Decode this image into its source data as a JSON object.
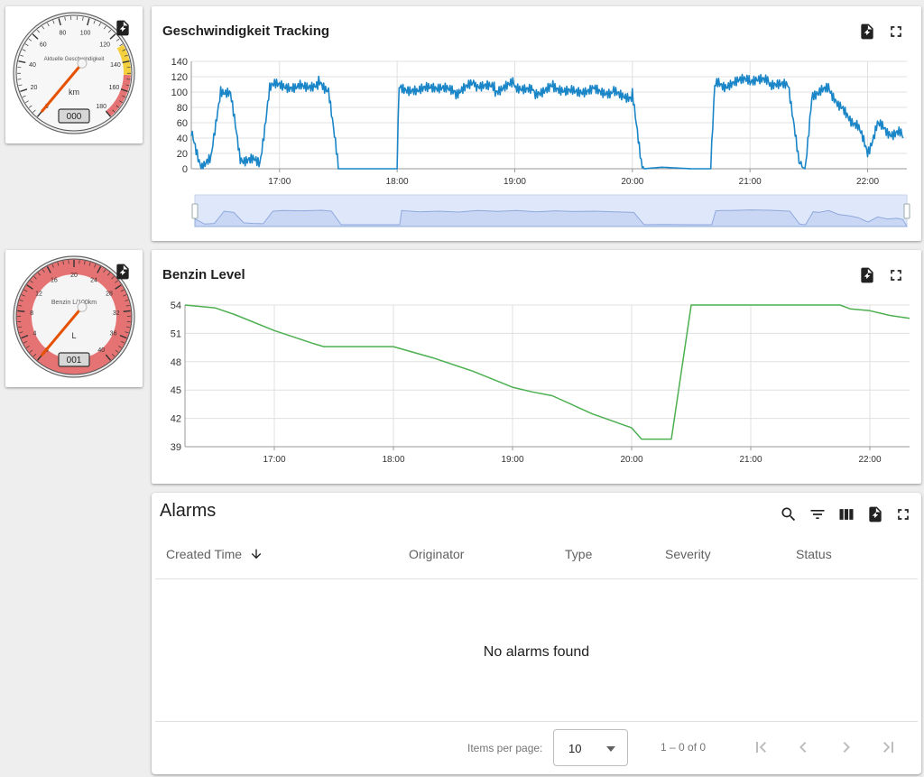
{
  "gauge_speed": {
    "label": "Aktuelle Geschwindigkeit",
    "unit": "km",
    "value_display": "000",
    "ticks": [
      "0",
      "20",
      "40",
      "60",
      "80",
      "100",
      "120",
      "140",
      "160",
      "180"
    ]
  },
  "gauge_fuel": {
    "label": "Benzin L/100km",
    "unit": "L",
    "value_display": "001",
    "ticks": [
      "0",
      "4",
      "8",
      "12",
      "16",
      "20",
      "24",
      "28",
      "32",
      "36",
      "40"
    ]
  },
  "speed_chart": {
    "title": "Geschwindigkeit Tracking"
  },
  "fuel_chart": {
    "title": "Benzin Level"
  },
  "chart_data": [
    {
      "type": "line",
      "title": "Geschwindigkeit Tracking",
      "x_unit": "time",
      "x": [
        "16:15",
        "16:20",
        "16:25",
        "16:30",
        "16:35",
        "16:40",
        "16:45",
        "16:50",
        "16:55",
        "17:00",
        "17:10",
        "17:20",
        "17:25",
        "17:30",
        "17:35",
        "17:40",
        "17:45",
        "17:50",
        "17:55",
        "18:00",
        "18:01",
        "18:10",
        "18:20",
        "18:30",
        "18:40",
        "18:50",
        "19:00",
        "19:10",
        "19:20",
        "19:30",
        "19:40",
        "19:50",
        "20:00",
        "20:05",
        "20:06",
        "20:15",
        "20:30",
        "20:40",
        "20:42",
        "20:45",
        "20:50",
        "21:00",
        "21:10",
        "21:20",
        "21:25",
        "21:28",
        "21:32",
        "21:35",
        "21:40",
        "21:45",
        "21:50",
        "21:55",
        "22:00",
        "22:05",
        "22:10",
        "22:15",
        "22:18"
      ],
      "series": [
        {
          "values": [
            45,
            5,
            10,
            105,
            95,
            15,
            10,
            8,
            105,
            110,
            108,
            112,
            105,
            0,
            0,
            0,
            0,
            0,
            0,
            0,
            110,
            100,
            105,
            98,
            110,
            103,
            110,
            100,
            108,
            102,
            105,
            100,
            95,
            5,
            0,
            2,
            0,
            0,
            108,
            110,
            110,
            115,
            112,
            105,
            5,
            0,
            100,
            95,
            110,
            80,
            70,
            55,
            20,
            60,
            45,
            50,
            40
          ],
          "color": "#1a86c8"
        }
      ],
      "xlim": [
        "16:15",
        "22:20"
      ],
      "xticks": [
        "17:00",
        "18:00",
        "19:00",
        "20:00",
        "21:00",
        "22:00"
      ],
      "ylim": [
        0,
        140
      ],
      "yticks": [
        "0",
        "20",
        "40",
        "60",
        "80",
        "100",
        "120",
        "140"
      ],
      "grid": true
    },
    {
      "type": "line",
      "title": "Benzin Level",
      "x_unit": "time",
      "x": [
        "16:15",
        "16:30",
        "16:40",
        "17:00",
        "17:20",
        "17:25",
        "17:40",
        "18:00",
        "18:20",
        "18:40",
        "19:00",
        "19:10",
        "19:20",
        "19:40",
        "20:00",
        "20:05",
        "20:20",
        "20:30",
        "20:45",
        "21:00",
        "21:30",
        "21:45",
        "21:50",
        "22:00",
        "22:10",
        "22:20"
      ],
      "series": [
        {
          "values": [
            54,
            53.7,
            53,
            51.3,
            49.9,
            49.6,
            49.6,
            49.6,
            48.4,
            47,
            45.3,
            44.8,
            44.4,
            42.5,
            41,
            39.8,
            39.8,
            54,
            54,
            54,
            54,
            54,
            53.6,
            53.4,
            52.9,
            52.6
          ],
          "color": "#4caf50"
        }
      ],
      "xlim": [
        "16:15",
        "22:20"
      ],
      "xticks": [
        "17:00",
        "18:00",
        "19:00",
        "20:00",
        "21:00",
        "22:00"
      ],
      "ylim": [
        39,
        54
      ],
      "yticks": [
        "39",
        "42",
        "45",
        "48",
        "51",
        "54"
      ],
      "grid": true
    }
  ],
  "alarms": {
    "title": "Alarms",
    "columns": {
      "created_time": "Created Time",
      "originator": "Originator",
      "type": "Type",
      "severity": "Severity",
      "status": "Status"
    },
    "empty_message": "No alarms found",
    "items_per_page_label": "Items per page:",
    "items_per_page_value": "10",
    "range_label": "1 – 0 of 0"
  },
  "colors": {
    "speed_line": "#1a86c8",
    "fuel_line": "#4caf50",
    "gauge_red": "#e57373",
    "gauge_yellow": "#f4d03f"
  }
}
